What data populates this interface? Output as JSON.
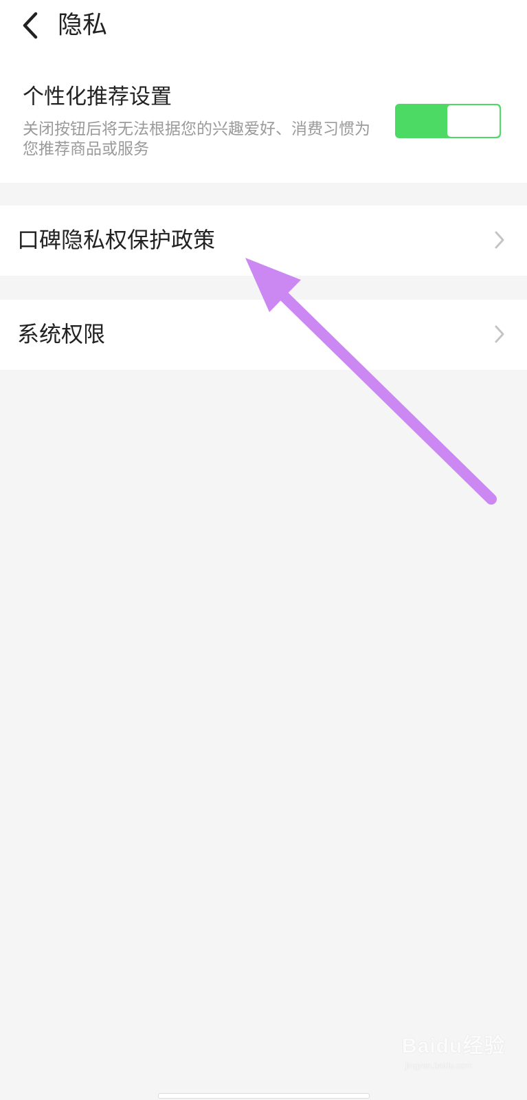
{
  "header": {
    "title": "隐私",
    "back_icon": "chevron-left-icon"
  },
  "personalized_recommendation": {
    "title": "个性化推荐设置",
    "description": "关闭按钮后将无法根据您的兴趣爱好、消费习惯为您推荐商品或服务",
    "toggle_on": true,
    "toggle_color": "#4cd964"
  },
  "rows": [
    {
      "label": "口碑隐私权保护政策",
      "icon": "chevron-right-icon"
    },
    {
      "label": "系统权限",
      "icon": "chevron-right-icon"
    }
  ],
  "annotation": {
    "arrow_color": "#cc88f2"
  },
  "watermark": {
    "text": "Baidu经验",
    "subtext": "jingyan.baidu.com"
  }
}
